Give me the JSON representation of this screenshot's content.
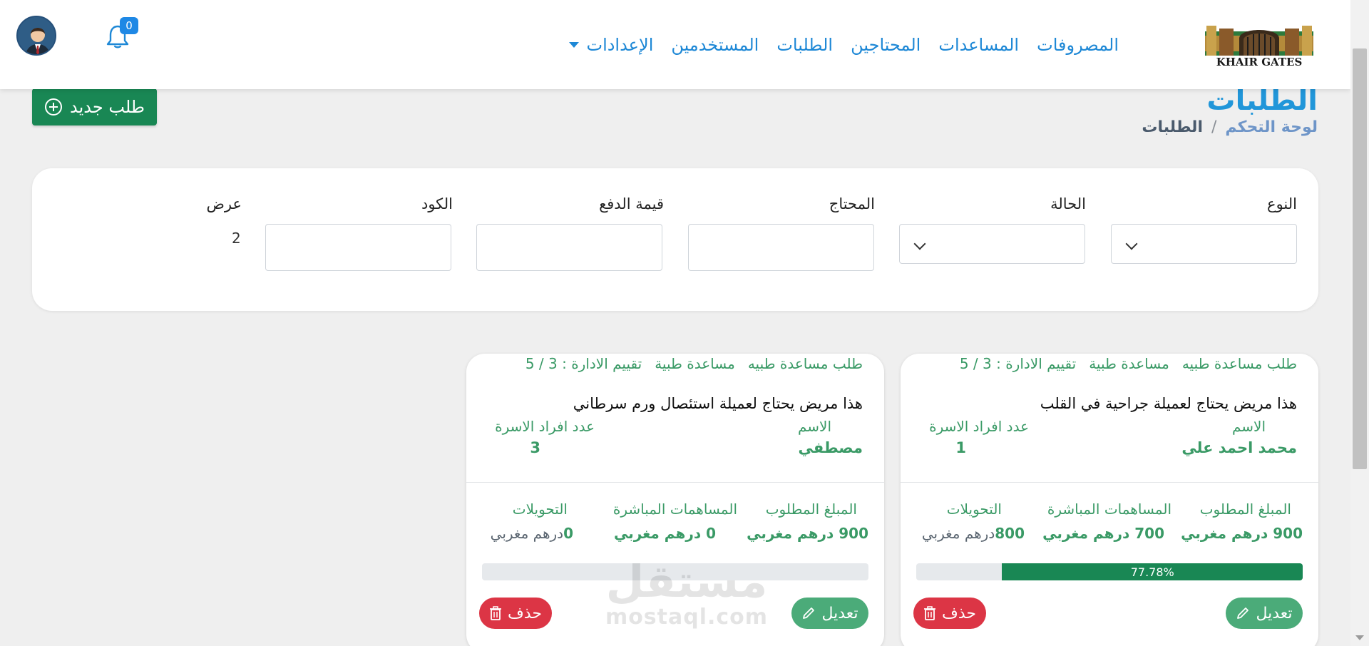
{
  "header": {
    "notifications_count": "0",
    "nav": [
      {
        "label": "الإعدادات",
        "dropdown": true
      },
      {
        "label": "المستخدمين"
      },
      {
        "label": "الطلبات"
      },
      {
        "label": "المحتاجين"
      },
      {
        "label": "المساعدات"
      },
      {
        "label": "المصروفات"
      }
    ],
    "logo_text": "KHAIR GATES"
  },
  "page": {
    "title": "الطلبات",
    "breadcrumb_home": "لوحة التحكم",
    "breadcrumb_sep": "/",
    "breadcrumb_current": "الطلبات",
    "new_button": "طلب جديد"
  },
  "filters": {
    "type_label": "النوع",
    "status_label": "الحالة",
    "needy_label": "المحتاج",
    "payment_label": "قيمة الدفع",
    "code_label": "الكود",
    "show_label": "عرض",
    "show_value": "2"
  },
  "cards": [
    {
      "tag_type": "طلب مساعدة طبيه",
      "tag_category": "مساعدة طبية",
      "rating": "تقييم الادارة : 3 / 5",
      "description": "هذا مريض يحتاج لعميلة جراحية في القلب",
      "name_label": "الاسم",
      "name": "محمد احمد علي",
      "family_label": "عدد افراد الاسرة",
      "family_count": "1",
      "required_label": "المبلغ المطلوب",
      "required": "900 درهم مغربي",
      "direct_label": "المساهمات المباشرة",
      "direct": "700 درهم مغربي",
      "transfers_label": "التحويلات",
      "transfers_amount": "800",
      "transfers_currency": "درهم مغربي",
      "progress": 0.7778,
      "progress_text": "77.78%",
      "edit": "تعديل",
      "delete": "حذف"
    },
    {
      "tag_type": "طلب مساعدة طبيه",
      "tag_category": "مساعدة طبية",
      "rating": "تقييم الادارة : 3 / 5",
      "description": "هذا مريض يحتاج لعميلة استئصال ورم سرطاني",
      "name_label": "الاسم",
      "name": "مصطفي",
      "family_label": "عدد افراد الاسرة",
      "family_count": "3",
      "required_label": "المبلغ المطلوب",
      "required": "900 درهم مغربي",
      "direct_label": "المساهمات المباشرة",
      "direct": "0 درهم مغربي",
      "transfers_label": "التحويلات",
      "transfers_amount": "0",
      "transfers_currency": "درهم مغربي",
      "progress": 0,
      "progress_text": "",
      "edit": "تعديل",
      "delete": "حذف"
    }
  ],
  "watermark": {
    "arabic": "مستقل",
    "latin": "mostaql.com"
  },
  "colors": {
    "brand_blue": "#1e88d6",
    "success": "#198754",
    "edit_green": "#4bab79",
    "danger": "#dc3545",
    "text_green": "#3a9a66"
  }
}
